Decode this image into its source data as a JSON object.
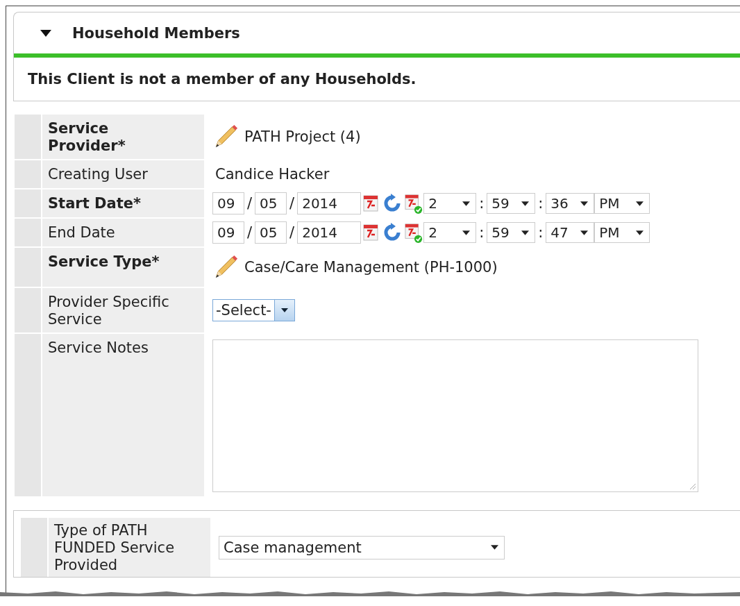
{
  "section": {
    "title": "Household Members",
    "expanded": true,
    "message": "This Client is not a member of any Households."
  },
  "fields": [
    {
      "kind": "link",
      "label": "Service Provider",
      "required": true,
      "mark": "*",
      "value": "PATH Project (4)"
    },
    {
      "kind": "text",
      "label": "Creating User",
      "required": false,
      "value": "Candice Hacker"
    },
    {
      "kind": "datetime",
      "label": "Start Date",
      "required": true,
      "mark": "*",
      "date": [
        "09",
        "05",
        "2014"
      ],
      "date_separator": "/",
      "time": [
        "2",
        "59",
        "36",
        "PM"
      ],
      "time_separator": ":"
    },
    {
      "kind": "datetime",
      "label": "End Date",
      "required": false,
      "date": [
        "09",
        "05",
        "2014"
      ],
      "date_separator": "/",
      "time": [
        "2",
        "59",
        "47",
        "PM"
      ],
      "time_separator": ":"
    },
    {
      "kind": "link",
      "label": "Service Type",
      "required": true,
      "mark": "*",
      "value": "Case/Care Management (PH-1000)"
    },
    {
      "kind": "select",
      "label": "Provider Specific Service",
      "required": false,
      "value": "-Select-"
    },
    {
      "kind": "notes",
      "label": "Service Notes",
      "required": false
    }
  ],
  "extra_fields": [
    {
      "kind": "dropdown",
      "label": "Type of PATH FUNDED Service Provided",
      "value": "Case management"
    }
  ]
}
